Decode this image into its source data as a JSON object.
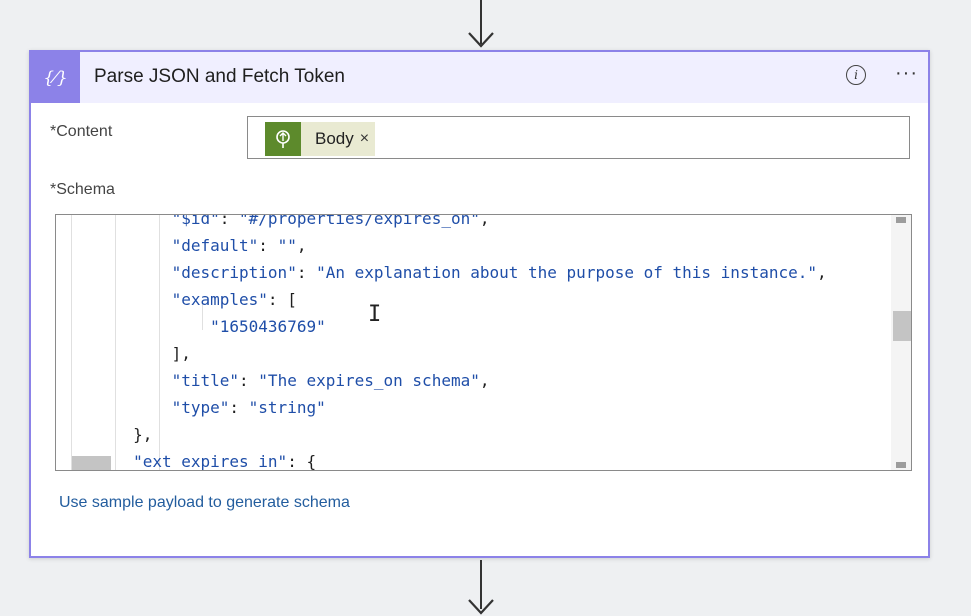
{
  "card": {
    "title": "Parse JSON and Fetch Token",
    "action_icon": "{⁄}",
    "info_icon": "i",
    "more_icon": "···"
  },
  "content_field": {
    "label": "Content",
    "required_mark": "*",
    "token_label": "Body",
    "token_remove": "×"
  },
  "schema_field": {
    "label": "Schema",
    "required_mark": "*",
    "lines": [
      {
        "indent": "        ",
        "key": "\"$id\"",
        "sep": ": ",
        "value": "\"#/properties/expires_on\"",
        "tail": ","
      },
      {
        "indent": "        ",
        "key": "\"default\"",
        "sep": ": ",
        "value": "\"\"",
        "tail": ","
      },
      {
        "indent": "        ",
        "key": "\"description\"",
        "sep": ": ",
        "value": "\"An explanation about the purpose of this instance.\"",
        "tail": ","
      },
      {
        "indent": "        ",
        "key": "\"examples\"",
        "sep": ": ",
        "value": "",
        "tail": "["
      },
      {
        "indent": "            ",
        "key": "",
        "sep": "",
        "value": "\"1650436769\"",
        "tail": ""
      },
      {
        "indent": "        ",
        "key": "",
        "sep": "",
        "value": "",
        "tail": "],"
      },
      {
        "indent": "        ",
        "key": "\"title\"",
        "sep": ": ",
        "value": "\"The expires_on schema\"",
        "tail": ","
      },
      {
        "indent": "        ",
        "key": "\"type\"",
        "sep": ": ",
        "value": "\"string\"",
        "tail": ""
      },
      {
        "indent": "    ",
        "key": "",
        "sep": "",
        "value": "",
        "tail": "},"
      },
      {
        "indent": "    ",
        "key": "\"ext_expires_in\"",
        "sep": ": ",
        "value": "",
        "tail": "{"
      }
    ]
  },
  "sample_link": "Use sample payload to generate schema",
  "colors": {
    "accent": "#8c82e8",
    "header_bg": "#f0efff",
    "token_icon_bg": "#5d8a2c",
    "link": "#235d9e",
    "json_string": "#1f4ea8"
  }
}
